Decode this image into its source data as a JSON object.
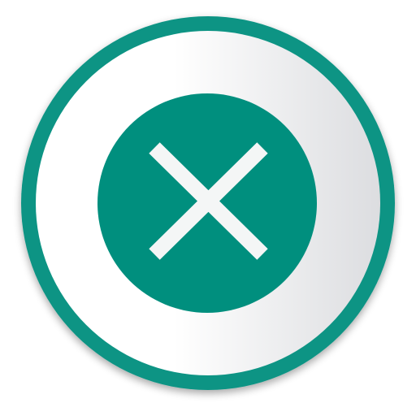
{
  "icon": {
    "name": "close-icon",
    "glyph": "close",
    "colors": {
      "outer_ring": "#0e9484",
      "disc_light": "#ffffff",
      "disc_shade": "#dcdde0",
      "center_circle": "#008f7e",
      "cross": "#f4f6f6"
    }
  }
}
